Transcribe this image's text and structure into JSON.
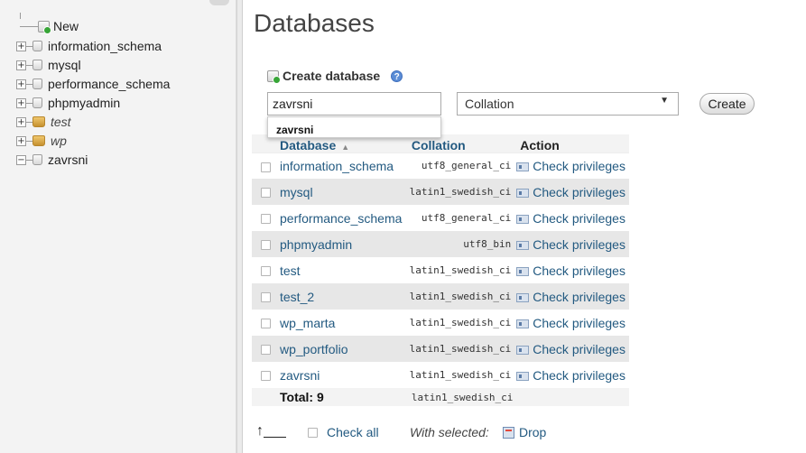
{
  "nav": {
    "new_label": "New",
    "databases": [
      {
        "name": "information_schema",
        "expander": "+",
        "special": false
      },
      {
        "name": "mysql",
        "expander": "+",
        "special": false
      },
      {
        "name": "performance_schema",
        "expander": "+",
        "special": false
      },
      {
        "name": "phpmyadmin",
        "expander": "+",
        "special": false
      },
      {
        "name": "test",
        "expander": "+",
        "special": true
      },
      {
        "name": "wp",
        "expander": "+",
        "special": true
      },
      {
        "name": "zavrsni",
        "expander": "−",
        "special": false
      }
    ]
  },
  "main": {
    "title": "Databases",
    "create_label": "Create database",
    "dbname_value": "zavrsni",
    "autocomplete_suggestion": "zavrsni",
    "collation_placeholder": "Collation",
    "create_button": "Create"
  },
  "table": {
    "headers": {
      "database": "Database",
      "collation": "Collation",
      "action": "Action"
    },
    "action_label": "Check privileges",
    "rows": [
      {
        "name": "information_schema",
        "collation": "utf8_general_ci"
      },
      {
        "name": "mysql",
        "collation": "latin1_swedish_ci"
      },
      {
        "name": "performance_schema",
        "collation": "utf8_general_ci"
      },
      {
        "name": "phpmyadmin",
        "collation": "utf8_bin"
      },
      {
        "name": "test",
        "collation": "latin1_swedish_ci"
      },
      {
        "name": "test_2",
        "collation": "latin1_swedish_ci"
      },
      {
        "name": "wp_marta",
        "collation": "latin1_swedish_ci"
      },
      {
        "name": "wp_portfolio",
        "collation": "latin1_swedish_ci"
      },
      {
        "name": "zavrsni",
        "collation": "latin1_swedish_ci"
      }
    ],
    "total_label": "Total: 9",
    "total_collation": "latin1_swedish_ci"
  },
  "bottom": {
    "check_all": "Check all",
    "with_selected": "With selected:",
    "drop": "Drop"
  },
  "colors": {
    "link": "#235a81",
    "even_row": "#e7e7e7",
    "nav_bg": "#f3f3f3"
  }
}
